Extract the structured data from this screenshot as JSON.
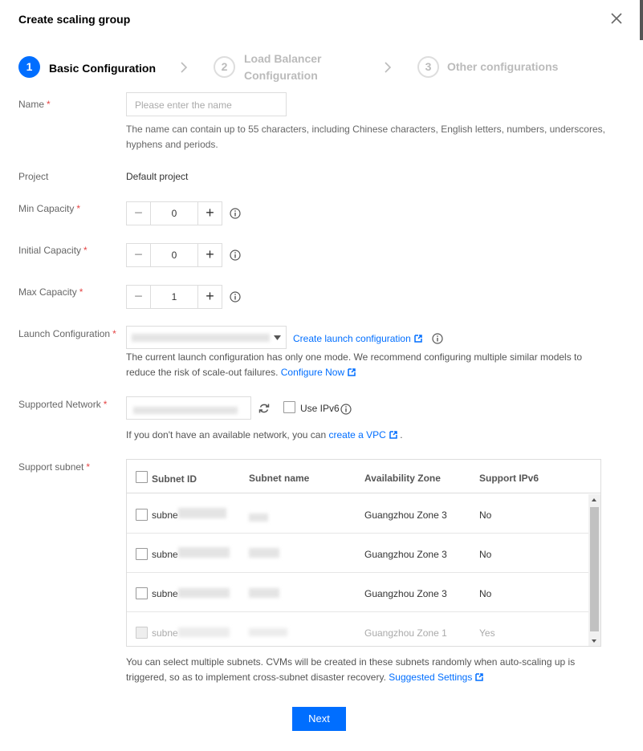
{
  "dialog": {
    "title": "Create scaling group"
  },
  "steps": [
    {
      "number": "1",
      "label": "Basic Configuration",
      "state": "active"
    },
    {
      "number": "2",
      "label_line1": "Load Balancer",
      "label_line2": "Configuration",
      "state": "inactive"
    },
    {
      "number": "3",
      "label": "Other configurations",
      "state": "inactive"
    }
  ],
  "form": {
    "name": {
      "label": "Name",
      "placeholder": "Please enter the name",
      "help_line1": "The name can contain up to 55 characters, including Chinese characters, English letters, numbers, underscores,",
      "help_line2": "hyphens and periods."
    },
    "project": {
      "label": "Project",
      "value": "Default project"
    },
    "min_capacity": {
      "label": "Min Capacity",
      "value": "0"
    },
    "initial_capacity": {
      "label": "Initial Capacity",
      "value": "0"
    },
    "max_capacity": {
      "label": "Max Capacity",
      "value": "1"
    },
    "launch_configuration": {
      "label": "Launch Configuration",
      "create_link": "Create launch configuration",
      "help_line1": "The current launch configuration has only one mode. We recommend configuring multiple similar models to",
      "help_line2": "reduce the risk of scale-out failures.",
      "configure_link": "Configure Now"
    },
    "supported_network": {
      "label": "Supported Network",
      "ipv6_label": "Use IPv6",
      "help_prefix": "If you don't have an available network, you can",
      "help_link": "create a VPC",
      "help_suffix": "."
    },
    "support_subnet": {
      "label": "Support subnet",
      "columns": [
        "Subnet ID",
        "Subnet name",
        "Availability Zone",
        "Support IPv6"
      ],
      "rows": [
        {
          "id_prefix": "subne",
          "zone": "Guangzhou Zone 3",
          "ipv6": "No",
          "disabled": false
        },
        {
          "id_prefix": "subne",
          "zone": "Guangzhou Zone 3",
          "ipv6": "No",
          "disabled": false
        },
        {
          "id_prefix": "subne",
          "zone": "Guangzhou Zone 3",
          "ipv6": "No",
          "disabled": false
        },
        {
          "id_prefix": "subne",
          "zone": "Guangzhou Zone 1",
          "ipv6": "Yes",
          "disabled": true
        }
      ],
      "help_line1": "You can select multiple subnets. CVMs will be created in these subnets randomly when auto-scaling up is",
      "help_line2": "triggered, so as to implement cross-subnet disaster recovery.",
      "help_link": "Suggested Settings"
    }
  },
  "footer": {
    "next_label": "Next"
  },
  "colors": {
    "primary": "#006eff",
    "required": "#e54545"
  }
}
